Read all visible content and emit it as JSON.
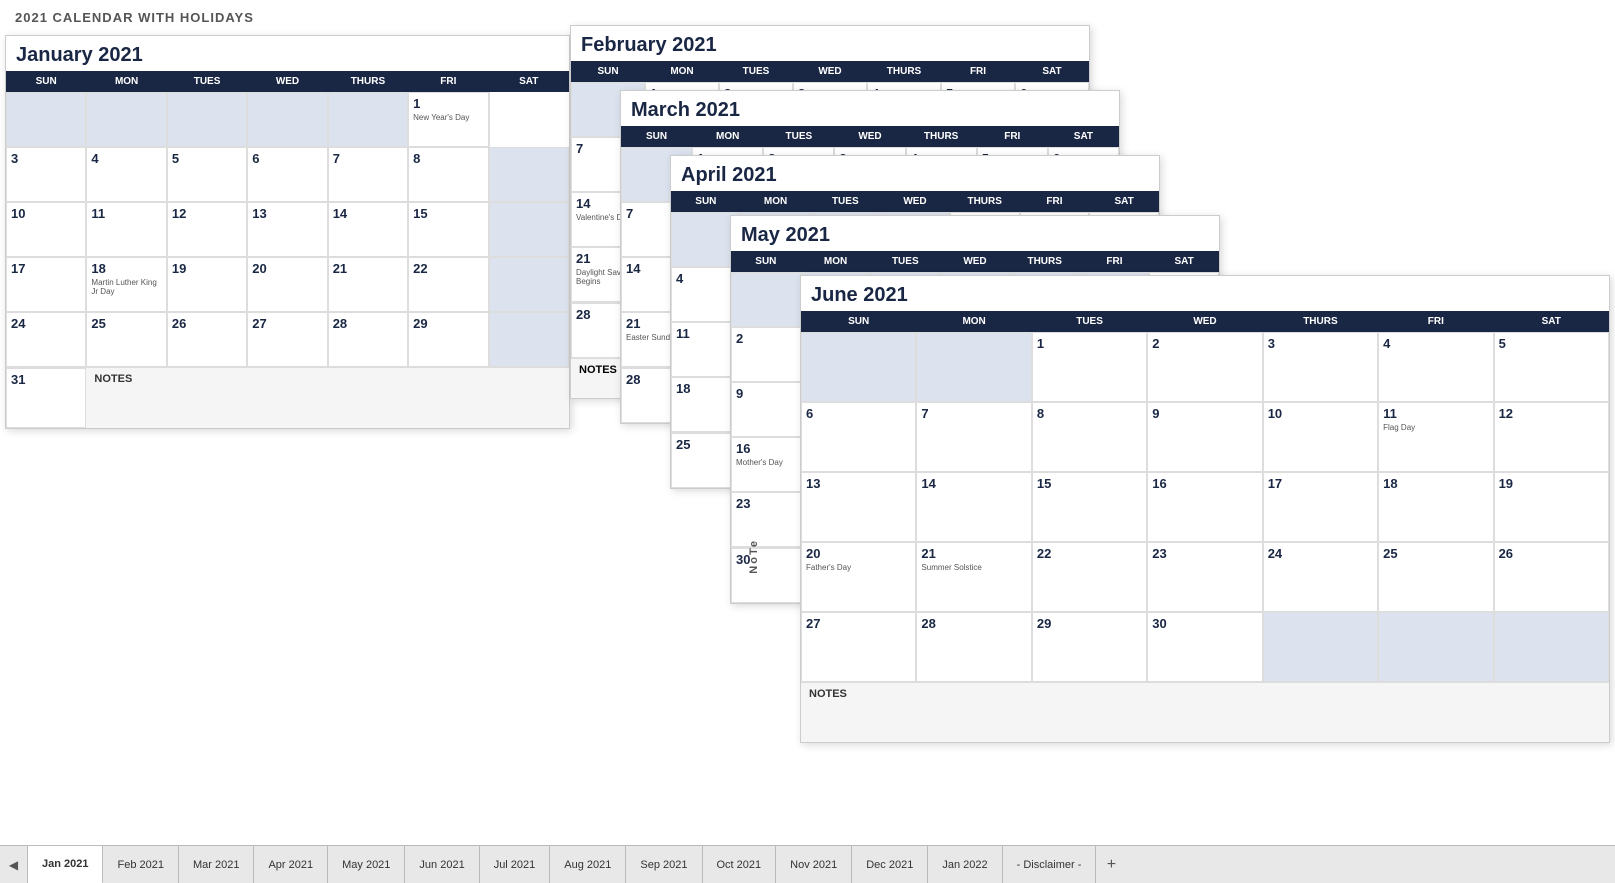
{
  "page": {
    "title": "2021 CALENDAR WITH HOLIDAYS"
  },
  "months": {
    "january": {
      "title": "January 2021",
      "headers": [
        "SUN",
        "MON",
        "TUES",
        "WED",
        "THURS",
        "FRI",
        "SAT"
      ],
      "rows": [
        [
          {
            "empty": true
          },
          {
            "empty": true
          },
          {
            "empty": true
          },
          {
            "empty": true
          },
          {
            "empty": true
          },
          {
            "n": "1",
            "h": "New Year's Day"
          },
          {
            "empty": true,
            "partial": true
          }
        ],
        [
          {
            "n": "3"
          },
          {
            "n": "4"
          },
          {
            "n": "5"
          },
          {
            "n": "6"
          },
          {
            "n": "7"
          },
          {
            "n": "8"
          },
          {
            "empty": true,
            "partial": true
          }
        ],
        [
          {
            "n": "10"
          },
          {
            "n": "11"
          },
          {
            "n": "12"
          },
          {
            "n": "13"
          },
          {
            "n": "14"
          },
          {
            "n": "15"
          },
          {
            "empty": true,
            "partial": true
          }
        ],
        [
          {
            "n": "17"
          },
          {
            "n": "18",
            "h": "Martin Luther King Jr Day"
          },
          {
            "n": "19"
          },
          {
            "n": "20"
          },
          {
            "n": "21"
          },
          {
            "n": "22"
          },
          {
            "empty": true,
            "partial": true
          }
        ],
        [
          {
            "n": "24"
          },
          {
            "n": "25"
          },
          {
            "n": "26"
          },
          {
            "n": "27"
          },
          {
            "n": "28"
          },
          {
            "n": "29"
          },
          {
            "empty": true,
            "partial": true
          }
        ],
        [
          {
            "n": "31"
          },
          {
            "notes": true,
            "span": 6
          }
        ]
      ],
      "notes_label": "NOTES"
    },
    "february": {
      "title": "February 2021",
      "headers": [
        "SUN",
        "MON",
        "TUES",
        "WED",
        "THURS",
        "FRI",
        "SAT"
      ]
    },
    "march": {
      "title": "March 2021",
      "headers": [
        "SUN",
        "MON",
        "TUES",
        "WED",
        "THURS",
        "FRI",
        "SAT"
      ]
    },
    "april": {
      "title": "April 2021",
      "headers": [
        "SUN",
        "MON",
        "TUES",
        "WED",
        "THURS",
        "FRI",
        "SAT"
      ]
    },
    "may": {
      "title": "May 2021",
      "headers": [
        "SUN",
        "MON",
        "TUES",
        "WED",
        "THURS",
        "FRI",
        "SAT"
      ]
    },
    "june": {
      "title": "June 2021",
      "headers": [
        "SUN",
        "MON",
        "TUES",
        "WED",
        "THURS",
        "FRI",
        "SAT"
      ],
      "rows": [
        [
          {
            "empty": true
          },
          {
            "empty": true
          },
          {
            "n": "1"
          },
          {
            "n": "2"
          },
          {
            "n": "3"
          },
          {
            "n": "4"
          },
          {
            "n": "5"
          }
        ],
        [
          {
            "n": "6"
          },
          {
            "n": "7"
          },
          {
            "n": "8"
          },
          {
            "n": "9"
          },
          {
            "n": "10"
          },
          {
            "n": "11"
          },
          {
            "n": "12"
          }
        ],
        [
          {
            "n": "13"
          },
          {
            "n": "14"
          },
          {
            "n": "15"
          },
          {
            "n": "16"
          },
          {
            "n": "17"
          },
          {
            "n": "18"
          },
          {
            "n": "19"
          }
        ],
        [
          {
            "n": "20",
            "h": "Father's Day"
          },
          {
            "n": "21",
            "h": "Summer Solstice"
          },
          {
            "n": "22"
          },
          {
            "n": "23"
          },
          {
            "n": "24"
          },
          {
            "n": "25"
          },
          {
            "n": "26"
          }
        ],
        [
          {
            "n": "27"
          },
          {
            "n": "28"
          },
          {
            "n": "29"
          },
          {
            "n": "30"
          },
          {
            "empty": true
          },
          {
            "empty": true
          },
          {
            "empty": true
          }
        ]
      ],
      "notes_label": "NOTES",
      "holidays": {
        "7": "Flag Day"
      }
    }
  },
  "tabs": {
    "items": [
      {
        "label": "Jan 2021",
        "active": true
      },
      {
        "label": "Feb 2021",
        "active": false
      },
      {
        "label": "Mar 2021",
        "active": false
      },
      {
        "label": "Apr 2021",
        "active": false
      },
      {
        "label": "May 2021",
        "active": false
      },
      {
        "label": "Jun 2021",
        "active": false
      },
      {
        "label": "Jul 2021",
        "active": false
      },
      {
        "label": "Aug 2021",
        "active": false
      },
      {
        "label": "Sep 2021",
        "active": false
      },
      {
        "label": "Oct 2021",
        "active": false
      },
      {
        "label": "Nov 2021",
        "active": false
      },
      {
        "label": "Dec 2021",
        "active": false
      },
      {
        "label": "Jan 2022",
        "active": false
      },
      {
        "label": "- Disclaimer -",
        "active": false
      }
    ]
  },
  "colors": {
    "header_bg": "#1a2744",
    "empty_cell": "#dce3ef"
  }
}
